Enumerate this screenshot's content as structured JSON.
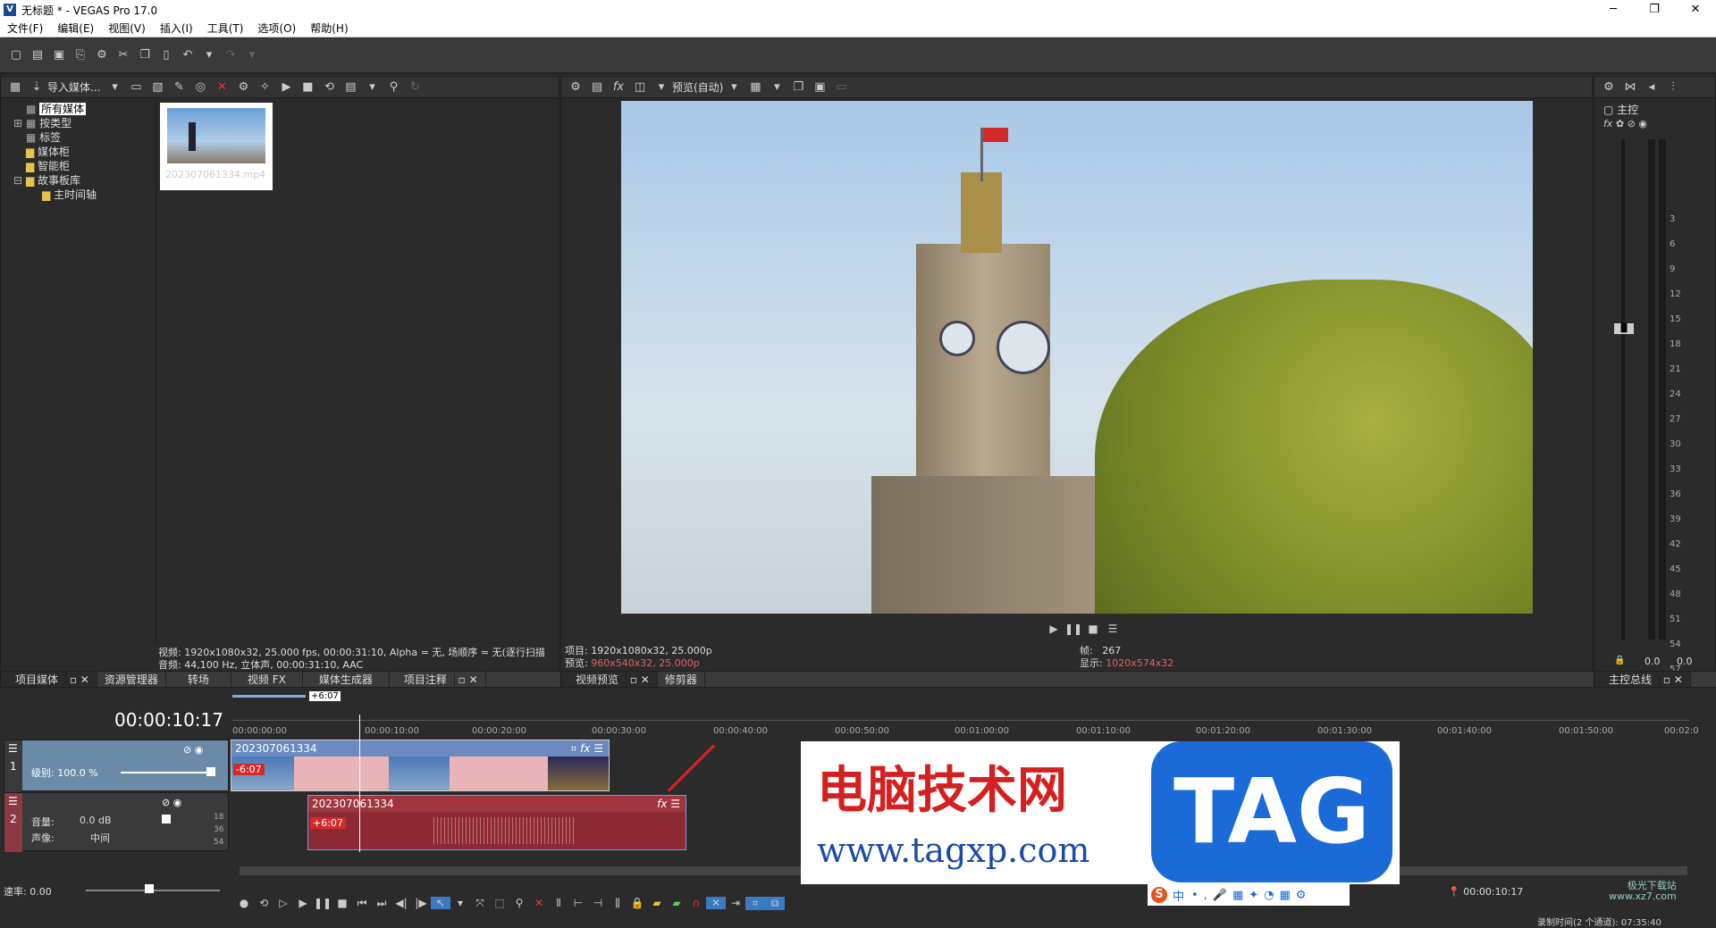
{
  "window": {
    "title": "无标题 * - VEGAS Pro 17.0",
    "logo": "V",
    "controls": [
      "─",
      "❐",
      "✕"
    ]
  },
  "menu": [
    "文件(F)",
    "编辑(E)",
    "视图(V)",
    "插入(I)",
    "工具(T)",
    "选项(O)",
    "帮助(H)"
  ],
  "media_panel": {
    "toolbar_label": "导入媒体...",
    "tree": [
      "所有媒体",
      "按类型",
      "标签",
      "媒体柜",
      "智能柜",
      "故事板库",
      "主时间轴"
    ],
    "thumbnail_name": "202307061334.mp4",
    "info_video": "视频: 1920x1080x32, 25.000 fps, 00:00:31:10, Alpha = 无, 场顺序 = 无(逐行扫描",
    "info_audio": "音频: 44,100 Hz, 立体声, 00:00:31:10, AAC",
    "tabs": [
      "项目媒体",
      "资源管理器",
      "转场",
      "视频 FX",
      "媒体生成器",
      "项目注释"
    ]
  },
  "preview_panel": {
    "toolbar_label": "预览(自动)",
    "project_label": "项目:",
    "project_value": "1920x1080x32, 25.000p",
    "preview_label": "预览:",
    "preview_value": "960x540x32, 25.000p",
    "frame_label": "帧:",
    "frame_value": "267",
    "display_label": "显示:",
    "display_value": "1020x574x32",
    "tabs": [
      "视频预览",
      "修剪器"
    ]
  },
  "master_panel": {
    "label": "主控",
    "scale": [
      "3",
      "6",
      "9",
      "12",
      "15",
      "18",
      "21",
      "24",
      "27",
      "30",
      "33",
      "36",
      "39",
      "42",
      "45",
      "48",
      "51",
      "54",
      "57"
    ],
    "left_value": "0.0",
    "right_value": "0.0",
    "tab": "主控总线"
  },
  "timeline": {
    "timecode": "00:00:10:17",
    "loop_label": "+6:07",
    "ruler": [
      "00:00:00:00",
      "00:00:10:00",
      "00:00:20:00",
      "00:00:30:00",
      "00:00:40:00",
      "00:00:50:00",
      "00:01:00:00",
      "00:01:10:00",
      "00:01:20:00",
      "00:01:30:00",
      "00:01:40:00",
      "00:01:50:00",
      "00:02:0"
    ],
    "video_track": {
      "num": "1",
      "level_label": "级别: 100.0 %",
      "clip_name": "202307061334",
      "clip_badge": "-6:07"
    },
    "audio_track": {
      "num": "2",
      "volume_label": "音量:",
      "volume_value": "0.0 dB",
      "pan_label": "声像:",
      "pan_value": "中间",
      "db_marks": [
        "18",
        "36",
        "54"
      ],
      "clip_name": "202307061334",
      "clip_badge": "+6:07"
    },
    "rate_label": "速率: 0.00",
    "end_timecode": "00:00:10:17",
    "record_time": "录制时间(2 个通道): 07:35:40"
  },
  "watermark": {
    "cn": "电脑技术网",
    "url": "www.tagxp.com",
    "tag": "TAG",
    "site": "极光下载站",
    "site_url": "www.xz7.com"
  },
  "ime": {
    "lang": "中",
    "logo": "S"
  },
  "colors": {
    "video_clip": "#e8b4b8",
    "audio_clip": "#8b2a35",
    "track_video": "#6a8aa8",
    "track_audio": "#8b3a44",
    "red_badge": "#d42a2a"
  }
}
